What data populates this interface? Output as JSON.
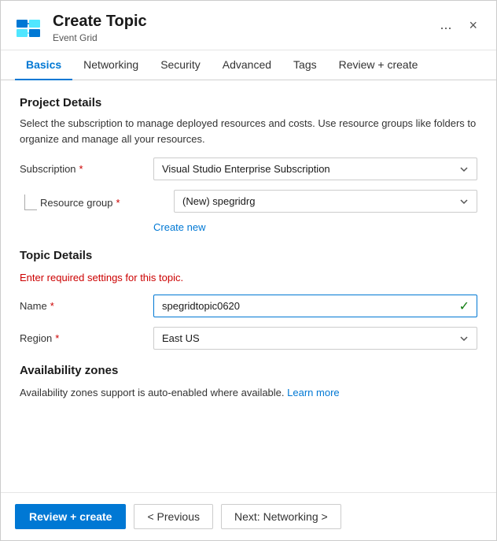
{
  "dialog": {
    "title": "Create Topic",
    "subtitle": "Event Grid",
    "ellipsis_label": "...",
    "close_label": "×"
  },
  "tabs": [
    {
      "id": "basics",
      "label": "Basics",
      "active": true
    },
    {
      "id": "networking",
      "label": "Networking",
      "active": false
    },
    {
      "id": "security",
      "label": "Security",
      "active": false
    },
    {
      "id": "advanced",
      "label": "Advanced",
      "active": false
    },
    {
      "id": "tags",
      "label": "Tags",
      "active": false
    },
    {
      "id": "review-create",
      "label": "Review + create",
      "active": false
    }
  ],
  "project_details": {
    "section_title": "Project Details",
    "section_desc": "Select the subscription to manage deployed resources and costs. Use resource groups like folders to organize and manage all your resources.",
    "subscription_label": "Subscription",
    "subscription_required": "*",
    "subscription_value": "Visual Studio Enterprise Subscription",
    "resource_group_label": "Resource group",
    "resource_group_required": "*",
    "resource_group_value": "(New) spegridrg",
    "create_new_label": "Create new"
  },
  "topic_details": {
    "section_title": "Topic Details",
    "section_desc": "Enter required settings for this topic.",
    "name_label": "Name",
    "name_required": "*",
    "name_value": "spegridtopic0620",
    "region_label": "Region",
    "region_required": "*",
    "region_value": "East US"
  },
  "availability_zones": {
    "section_title": "Availability zones",
    "desc_prefix": "Availability zones support is auto-enabled where available.",
    "learn_more_label": "Learn more",
    "learn_more_href": "#"
  },
  "footer": {
    "review_create_label": "Review + create",
    "previous_label": "< Previous",
    "next_label": "Next: Networking >"
  }
}
